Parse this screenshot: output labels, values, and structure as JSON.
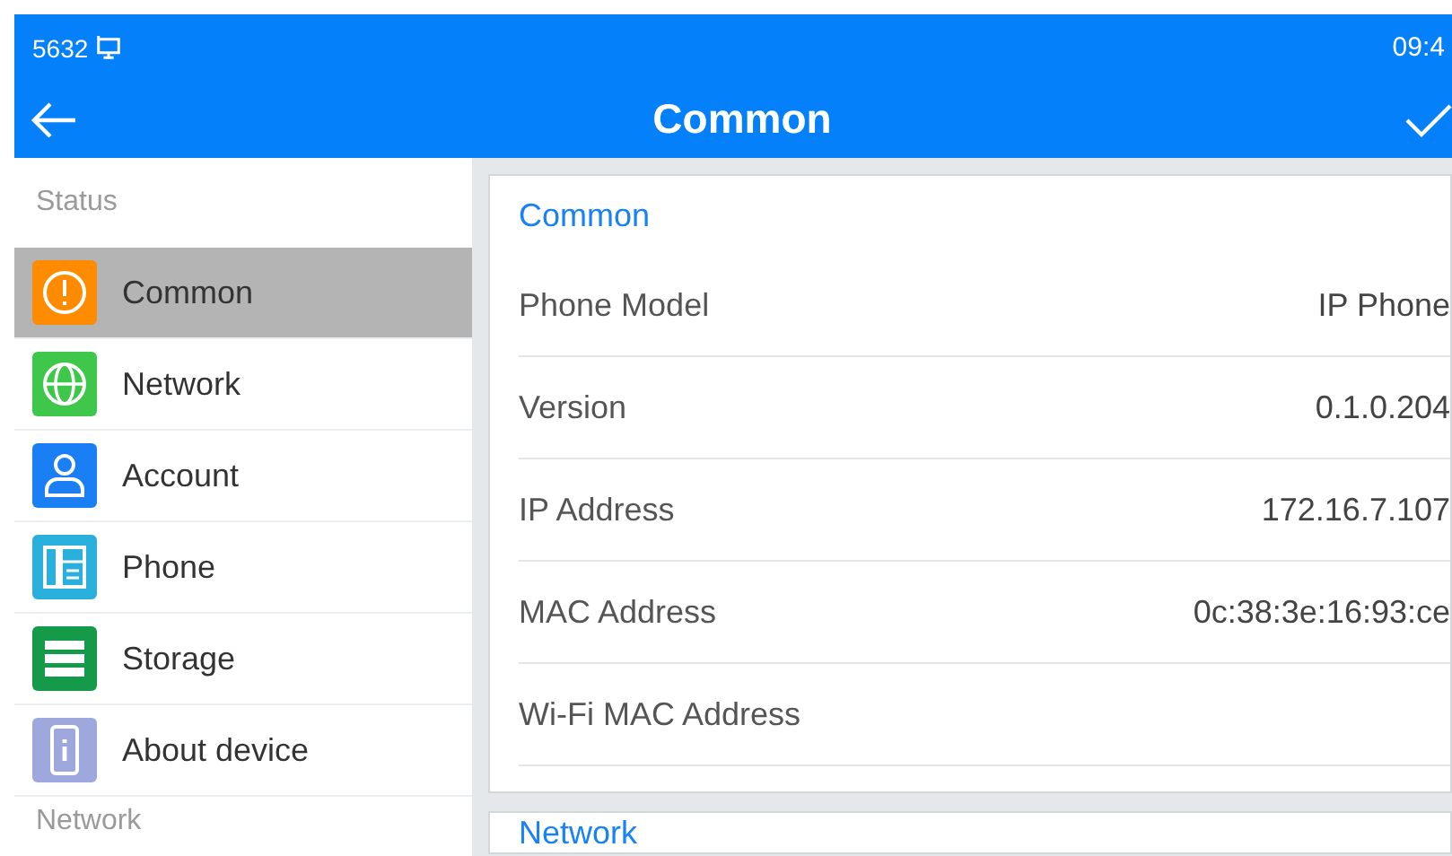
{
  "status_bar": {
    "extension": "5632",
    "time": "09:4"
  },
  "header": {
    "title": "Common"
  },
  "sidebar": {
    "groups": [
      {
        "title": "Status",
        "items": [
          {
            "label": "Common",
            "kind": "alert",
            "color": "#ff8c00",
            "selected": true
          },
          {
            "label": "Network",
            "kind": "globe",
            "color": "#3ec74a",
            "selected": false
          },
          {
            "label": "Account",
            "kind": "person",
            "color": "#1a7ff5",
            "selected": false
          },
          {
            "label": "Phone",
            "kind": "phone",
            "color": "#2ab0dc",
            "selected": false
          },
          {
            "label": "Storage",
            "kind": "storage",
            "color": "#159a4a",
            "selected": false
          },
          {
            "label": "About device",
            "kind": "device",
            "color": "#9fa8dc",
            "selected": false
          }
        ]
      },
      {
        "title": "Network"
      }
    ]
  },
  "sections": [
    {
      "title": "Common",
      "rows": [
        {
          "label": "Phone Model",
          "value": "IP Phone"
        },
        {
          "label": "Version",
          "value": "0.1.0.204"
        },
        {
          "label": "IP Address",
          "value": "172.16.7.107"
        },
        {
          "label": "MAC Address",
          "value": "0c:38:3e:16:93:ce"
        },
        {
          "label": "Wi-Fi MAC Address"
        }
      ]
    },
    {
      "title": "Network"
    }
  ]
}
